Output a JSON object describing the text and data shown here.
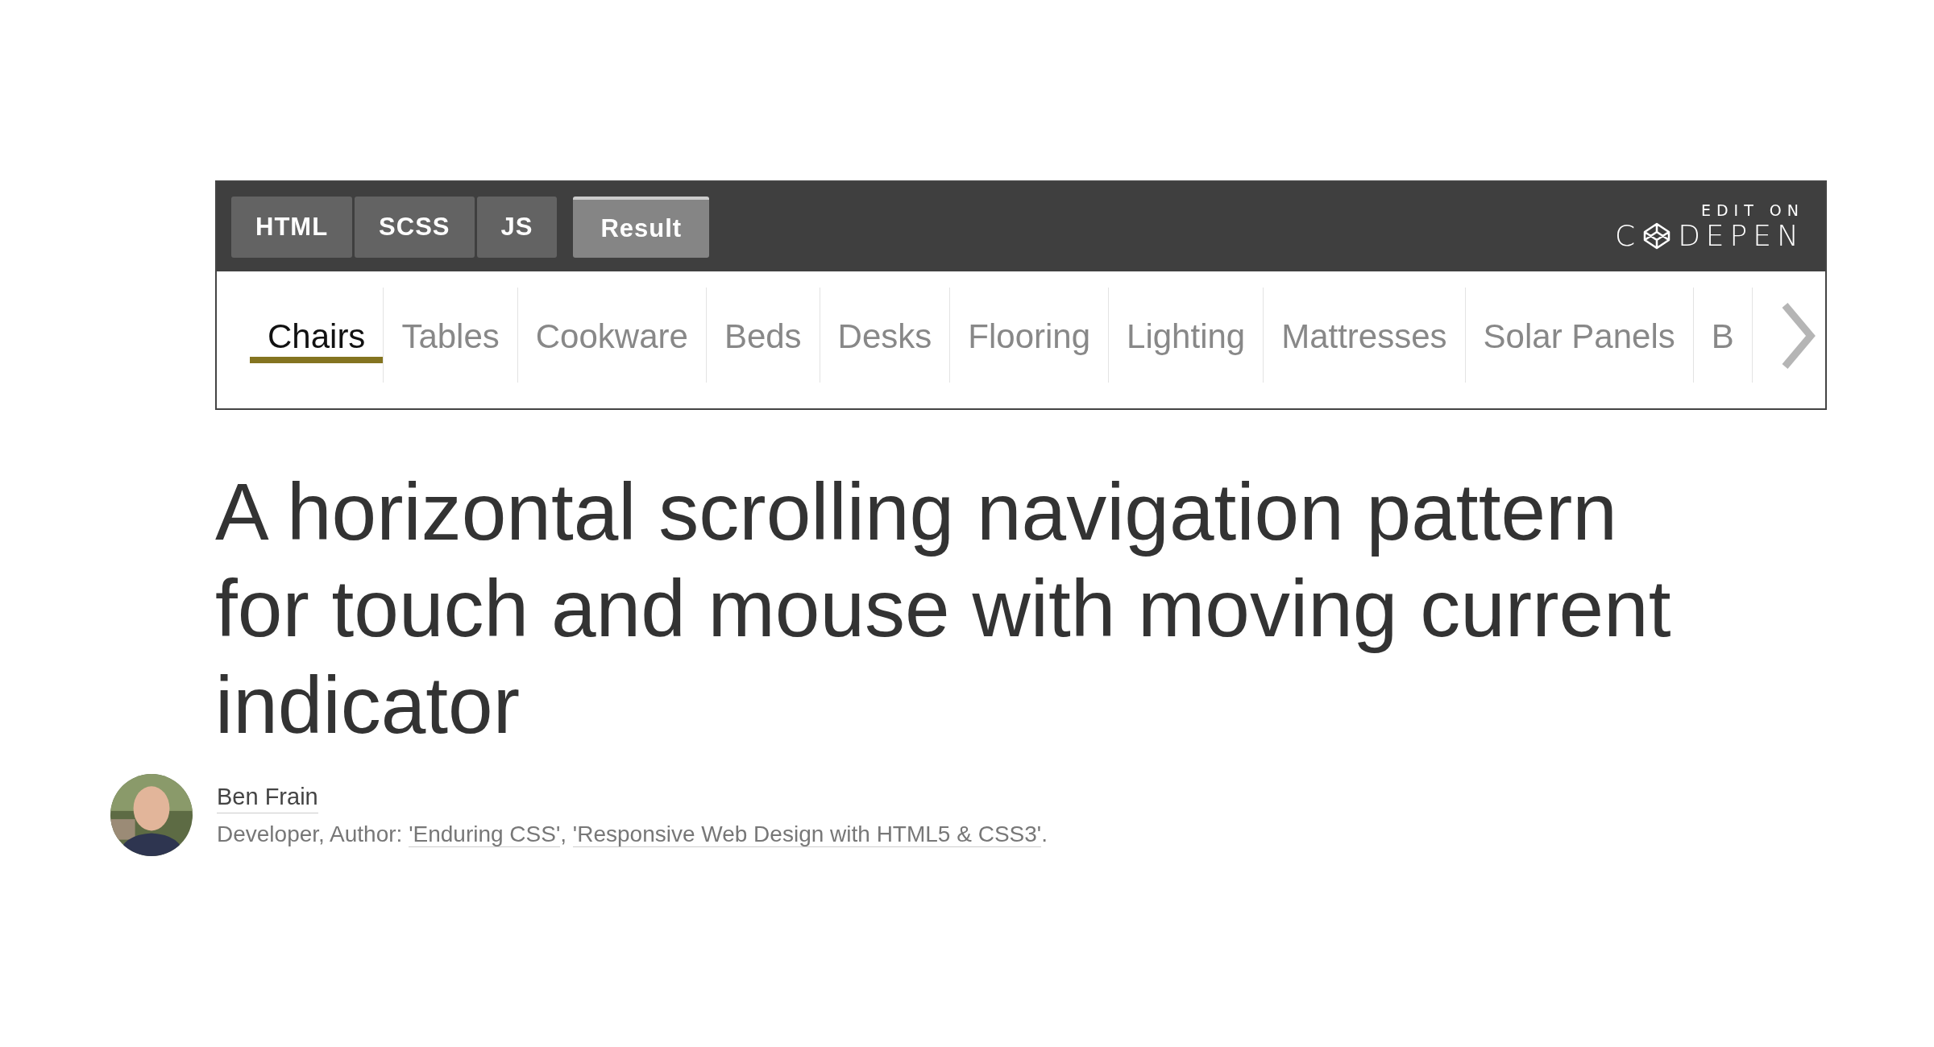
{
  "editor_tabs": [
    {
      "label": "HTML",
      "selected": false
    },
    {
      "label": "SCSS",
      "selected": false
    },
    {
      "label": "JS",
      "selected": false
    },
    {
      "label": "Result",
      "selected": true
    }
  ],
  "brand": {
    "top": "EDIT ON",
    "left": "C",
    "right": "DEPEN"
  },
  "nav": [
    {
      "label": "Chairs",
      "selected": true
    },
    {
      "label": "Tables",
      "selected": false
    },
    {
      "label": "Cookware",
      "selected": false
    },
    {
      "label": "Beds",
      "selected": false
    },
    {
      "label": "Desks",
      "selected": false
    },
    {
      "label": "Flooring",
      "selected": false
    },
    {
      "label": "Lighting",
      "selected": false
    },
    {
      "label": "Mattresses",
      "selected": false
    },
    {
      "label": "Solar Panels",
      "selected": false
    },
    {
      "label": "B",
      "selected": false
    }
  ],
  "title": "A horizontal scrolling navigation pattern for touch and mouse with moving current indicator",
  "author": {
    "name": "Ben Frain",
    "bio": {
      "lead": "Developer, Author: ",
      "links": [
        "'Enduring CSS'",
        "'Responsive Web Design with HTML5 & CSS3'"
      ],
      "separator": ", ",
      "end": "."
    }
  }
}
